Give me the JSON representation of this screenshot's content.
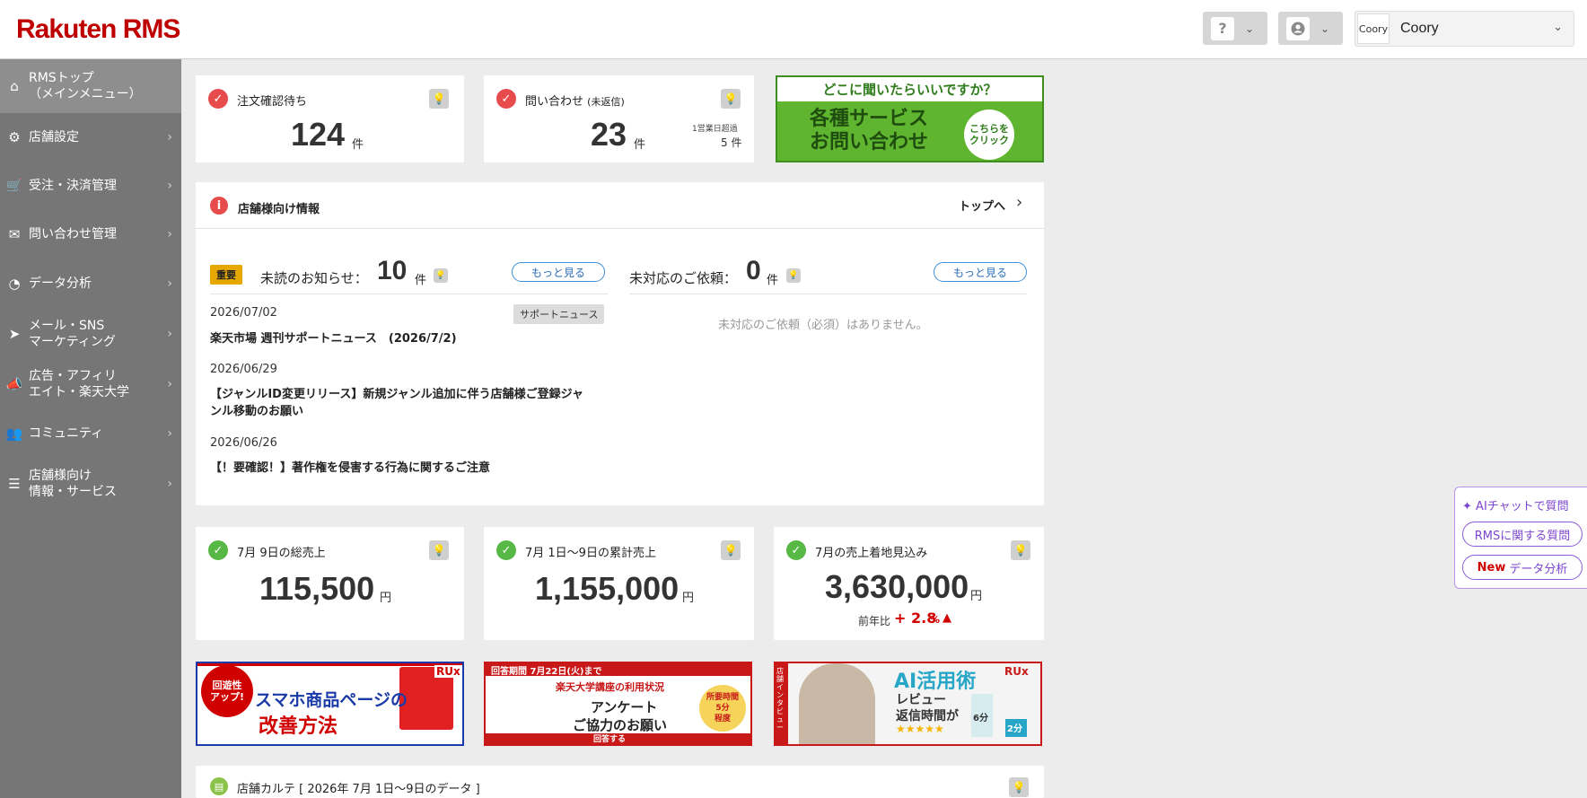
{
  "header": {
    "logo": "Rakuten RMS",
    "help_icon": "?",
    "user_icon": "👤",
    "account_badge": "Coory",
    "account_name": "Coory"
  },
  "sidebar": {
    "items": [
      {
        "label": "RMSトップ\n（メインメニュー）",
        "icon": "home-icon"
      },
      {
        "label": "店舗設定",
        "icon": "gear-icon"
      },
      {
        "label": "受注・決済管理",
        "icon": "cart-icon"
      },
      {
        "label": "問い合わせ管理",
        "icon": "chat-icon"
      },
      {
        "label": "データ分析",
        "icon": "pie-chart-icon"
      },
      {
        "label": "メール・SNS\nマーケティング",
        "icon": "send-icon"
      },
      {
        "label": "広告・アフィリ\nエイト・楽天大学",
        "icon": "megaphone-icon"
      },
      {
        "label": "コミュニティ",
        "icon": "people-icon"
      },
      {
        "label": "店舗様向け\n情報・サービス",
        "icon": "list-icon"
      }
    ]
  },
  "orders": {
    "title": "注文確認待ち",
    "count": "124",
    "unit": "件"
  },
  "inquiries": {
    "title": "問い合わせ",
    "title_sub": "(未返信)",
    "count": "23",
    "unit": "件",
    "overdue_label": "1営業日超過",
    "overdue_count": "5 件"
  },
  "service_banner": {
    "top": "どこに聞いたらいいですか？",
    "main": "各種サービス\nお問い合わせ",
    "click": "こちらを\nクリック"
  },
  "info": {
    "title": "店舗様向け情報",
    "top_link": "トップへ",
    "important_tag": "重要",
    "unread_label": "未読のお知らせ：",
    "unread_count": "10",
    "unread_unit": "件",
    "more_label": "もっと見る",
    "pending_label": "未対応のご依頼：",
    "pending_count": "0",
    "pending_unit": "件",
    "pending_more": "もっと見る",
    "pending_empty": "未対応のご依頼（必須）はありません。",
    "support_tag": "サポートニュース",
    "news": [
      {
        "date": "2026/07/02",
        "title": "楽天市場 週刊サポートニュース　(2026/7/2)"
      },
      {
        "date": "2026/06/29",
        "title": "【ジャンルID変更リリース】新規ジャンル追加に伴う店舗様ご登録ジャ\nンル移動のお願い"
      },
      {
        "date": "2026/06/26",
        "title": "【！要確認！】著作権を侵害する行為に関するご注意"
      }
    ]
  },
  "sales": [
    {
      "title": "7月 9日の総売上",
      "value": "115,500",
      "unit": "円"
    },
    {
      "title": "7月 1日〜9日の累計売上",
      "value": "1,155,000",
      "unit": "円"
    },
    {
      "title": "7月の売上着地見込み",
      "value": "3,630,000",
      "unit": "円",
      "yoy_label": "前年比",
      "yoy_value": "+ 2.8",
      "yoy_unit": "%",
      "yoy_arrow": "▲"
    }
  ],
  "ads": [
    {
      "tag": "RUx",
      "badge": "回遊性\nアップ!",
      "line1": "スマホ商品ページの",
      "line2": "改善方法"
    },
    {
      "header": "回答期間 7月22日(火)まで",
      "sub": "楽天大学講座の利用状況",
      "main1": "アンケート",
      "main2": "ご協力のお願い",
      "time": "所要時間\n5分\n程度",
      "footer": "回答する"
    },
    {
      "tag": "RUx",
      "side": "店舗インタビュー",
      "title": "AI活用術",
      "sub1": "レビュー",
      "sub2": "返信時間が",
      "before": "6分",
      "after": "2分"
    }
  ],
  "karte": {
    "title": "店舗カルテ [ 2026年 7月 1日〜9日のデータ ]"
  },
  "chat": {
    "ai": "AIチャットで質問",
    "rms": "RMSに関する質問",
    "new_tag": "New",
    "data": "データ分析"
  },
  "colors": {
    "brand": "#bf0000",
    "sidebar": "#767676",
    "green": "#57b846",
    "red": "#e74c4c",
    "purple": "#7b45cf"
  }
}
